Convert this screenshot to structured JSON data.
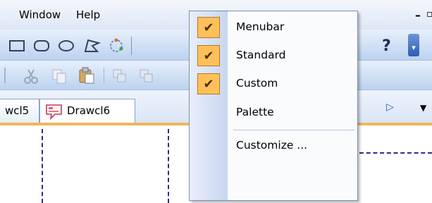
{
  "menubar": {
    "window_label": "Window",
    "help_label": "Help",
    "minimize_glyph": "–",
    "restore_glyph": "▫"
  },
  "document_tabs": {
    "prev_tab_partial": "wcl5",
    "active_tab": "Drawcl6",
    "scroll_right_glyph": "▷",
    "overflow_glyph": "▼"
  },
  "context_menu": {
    "items": [
      {
        "label": "Menubar",
        "checked": true
      },
      {
        "label": "Standard",
        "checked": true
      },
      {
        "label": "Custom",
        "checked": true
      },
      {
        "label": "Palette",
        "checked": false
      },
      {
        "label": "Customize ...",
        "checked": false
      }
    ],
    "check_glyph": "✔"
  },
  "toolbar": {
    "help_glyph": "?",
    "dropdown_glyph": "▾"
  },
  "colors": {
    "check_bg": "#ffc05a",
    "tab_accent": "#f0b65a",
    "toolbar_blue": "#cfdff5"
  }
}
